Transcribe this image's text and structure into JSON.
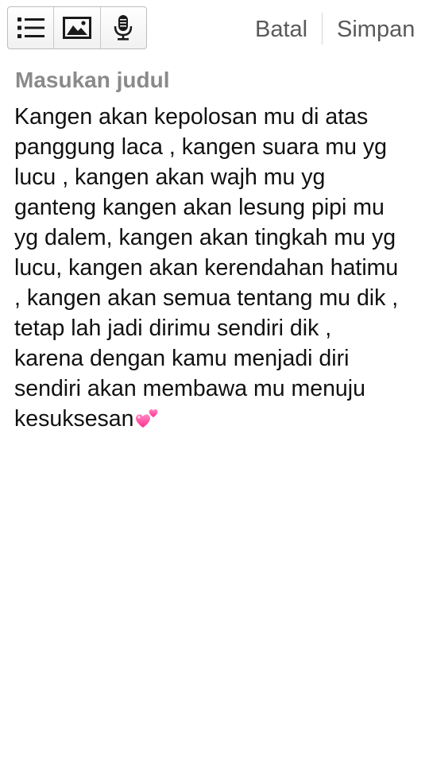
{
  "toolbar": {
    "tools": [
      {
        "name": "list",
        "icon": "list-icon"
      },
      {
        "name": "image",
        "icon": "image-icon"
      },
      {
        "name": "voice",
        "icon": "microphone-icon"
      }
    ],
    "cancel_label": "Batal",
    "save_label": "Simpan"
  },
  "title": {
    "placeholder": "Masukan judul",
    "value": ""
  },
  "body": {
    "lines": [
      "Kangen akan kepolosan mu di atas",
      "panggung laca , kangen suara mu yg",
      "lucu , kangen akan wajh mu yg",
      "ganteng kangen akan lesung pipi mu",
      "yg dalem, kangen akan tingkah mu yg",
      "lucu, kangen akan kerendahan hatimu",
      ", kangen akan semua tentang mu dik ,",
      "tetap lah jadi dirimu sendiri dik ,",
      "karena dengan kamu menjadi diri",
      "sendiri akan membawa mu menuju",
      "kesuksesan"
    ],
    "trailing_emoji_icon": "two-hearts-icon"
  },
  "colors": {
    "action_text": "#5a5a5a",
    "placeholder_text": "#8a8a8a",
    "body_text": "#111111",
    "heart": "#ff3d9a"
  }
}
